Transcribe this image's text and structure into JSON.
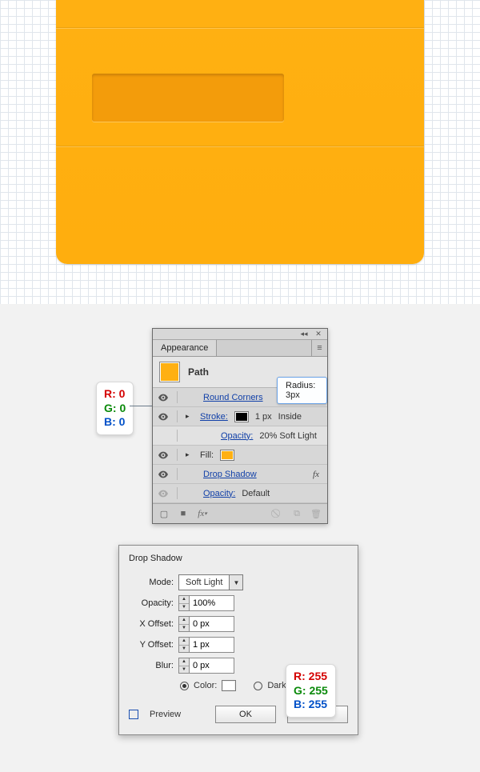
{
  "appearance": {
    "tab": "Appearance",
    "path_label": "Path",
    "rows": {
      "round_corners": "Round Corners",
      "stroke": "Stroke:",
      "stroke_val": "1 px",
      "stroke_align": "Inside",
      "stroke_opacity": "Opacity:",
      "stroke_opacity_val": "20% Soft Light",
      "fill": "Fill:",
      "drop_shadow": "Drop Shadow",
      "opacity": "Opacity:",
      "opacity_val": "Default"
    },
    "tooltip": "Radius: 3px"
  },
  "stroke_rgb": {
    "r": "R: 0",
    "g": "G: 0",
    "b": "B: 0"
  },
  "shadow_rgb": {
    "r": "R: 255",
    "g": "G: 255",
    "b": "B: 255"
  },
  "drop_shadow": {
    "title": "Drop Shadow",
    "mode_label": "Mode:",
    "mode_value": "Soft Light",
    "opacity_label": "Opacity:",
    "opacity_value": "100%",
    "xoff_label": "X Offset:",
    "xoff_value": "0 px",
    "yoff_label": "Y Offset:",
    "yoff_value": "1 px",
    "blur_label": "Blur:",
    "blur_value": "0 px",
    "color_label": "Color:",
    "darkness_label": "Darkn",
    "preview": "Preview",
    "ok": "OK",
    "cancel": "Cancel"
  }
}
